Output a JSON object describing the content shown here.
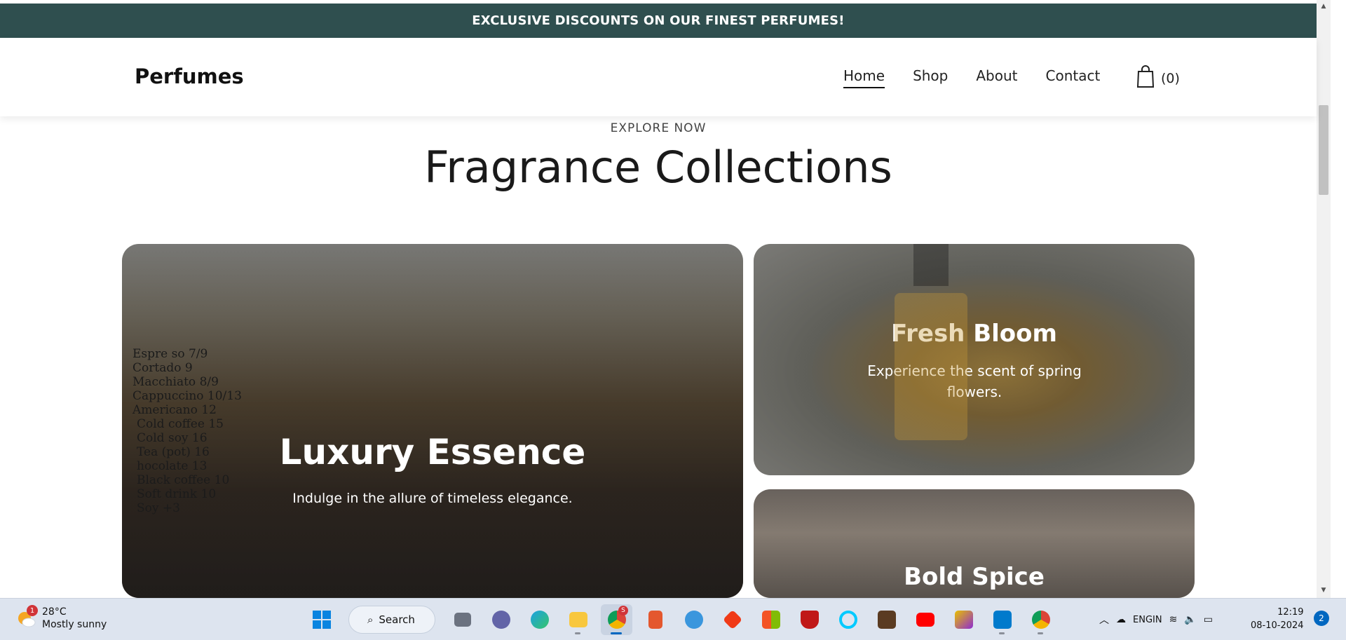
{
  "promo": {
    "text": "EXCLUSIVE DISCOUNTS ON OUR FINEST PERFUMES!"
  },
  "nav": {
    "logo": "Perfumes",
    "links": [
      "Home",
      "Shop",
      "About",
      "Contact"
    ],
    "active": "Home",
    "cart_count": "(0)"
  },
  "hero": {
    "eyebrow": "EXPLORE NOW",
    "heading": "Fragrance Collections"
  },
  "cards": [
    {
      "title": "Luxury Essence",
      "subtitle": "Indulge in the allure of timeless elegance."
    },
    {
      "title": "Fresh Bloom",
      "subtitle": "Experience the scent of spring flowers."
    },
    {
      "title": "Bold Spice",
      "subtitle": ""
    }
  ],
  "menu_board": [
    "Espre so  7/9",
    "Cortado  9",
    "Macchiato  8/9",
    "Cappuccino 10/13",
    "Americano  12",
    "Cold coffee  15",
    "Cold soy  16",
    "Tea (pot)  16",
    "hocolate  13",
    "Black coffee 10",
    "Soft drink  10",
    "Soy +3"
  ],
  "taskbar": {
    "weather_temp": "28°C",
    "weather_desc": "Mostly sunny",
    "weather_badge": "1",
    "search_label": "Search",
    "lang_line1": "ENG",
    "lang_line2": "IN",
    "time": "12:19",
    "date": "08-10-2024",
    "notification_count": "2",
    "chrome_badge": "S"
  },
  "colors": {
    "promo_bg": "#2f4f4f",
    "taskbar_bg": "#dde4ef",
    "accent": "#0067c0"
  }
}
